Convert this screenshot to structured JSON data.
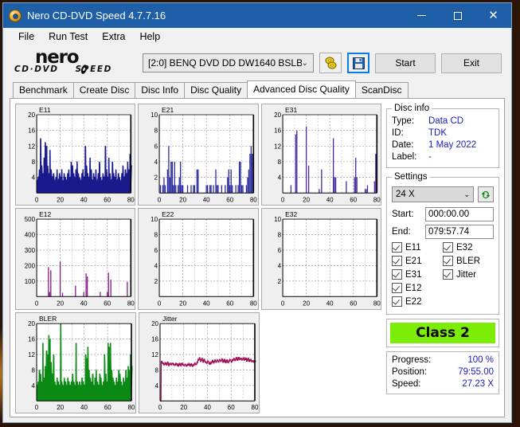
{
  "window": {
    "title": "Nero CD-DVD Speed 4.7.7.16",
    "icon": "nero-disc-icon",
    "minimize": "–",
    "maximize": "□",
    "close": "✕"
  },
  "menu": {
    "items": [
      "File",
      "Run Test",
      "Extra",
      "Help"
    ]
  },
  "toolbar": {
    "logo_primary": "nero",
    "logo_secondary": "CD·DVD",
    "logo_secondary2": "SPEED",
    "drive": "[2:0]   BENQ DVD DD DW1640 BSLB",
    "drive_chevron": "⌄",
    "eject_icon": "eject-disc-icon",
    "save_icon": "save-floppy-icon",
    "start_label": "Start",
    "exit_label": "Exit"
  },
  "tabs": [
    {
      "label": "Benchmark",
      "active": false
    },
    {
      "label": "Create Disc",
      "active": false
    },
    {
      "label": "Disc Info",
      "active": false
    },
    {
      "label": "Disc Quality",
      "active": false
    },
    {
      "label": "Advanced Disc Quality",
      "active": true
    },
    {
      "label": "ScanDisc",
      "active": false
    }
  ],
  "disc_info": {
    "legend": "Disc info",
    "rows": [
      {
        "key": "Type:",
        "value": "Data CD"
      },
      {
        "key": "ID:",
        "value": "TDK"
      },
      {
        "key": "Date:",
        "value": "1 May 2022"
      },
      {
        "key": "Label:",
        "value": "-"
      }
    ]
  },
  "settings": {
    "legend": "Settings",
    "speed": "24 X",
    "speed_chevron": "⌄",
    "refresh_icon": "refresh-speed-icon",
    "start_label": "Start:",
    "start_value": "000:00.00",
    "end_label": "End:",
    "end_value": "079:57.74",
    "checkboxes": [
      {
        "label": "E11",
        "checked": true
      },
      {
        "label": "E32",
        "checked": true
      },
      {
        "label": "E21",
        "checked": true
      },
      {
        "label": "BLER",
        "checked": true
      },
      {
        "label": "E31",
        "checked": true
      },
      {
        "label": "Jitter",
        "checked": true
      },
      {
        "label": "E12",
        "checked": true
      },
      {
        "label": "",
        "checked": false
      },
      {
        "label": "E22",
        "checked": true
      },
      {
        "label": "",
        "checked": false
      }
    ]
  },
  "quality_class": {
    "label": "Class 2",
    "color": "#7bed07"
  },
  "status": {
    "rows": [
      {
        "key": "Progress:",
        "value": "100 %"
      },
      {
        "key": "Position:",
        "value": "79:55.00"
      },
      {
        "key": "Speed:",
        "value": "27.23 X"
      }
    ]
  },
  "chart_data": [
    {
      "type": "area",
      "name": "E11",
      "title": "E11",
      "color": "#1a1a8c",
      "xlabel": "",
      "ylabel": "",
      "xlim": [
        0,
        80
      ],
      "ylim": [
        0,
        20
      ],
      "xticks": [
        0,
        20,
        40,
        60,
        80
      ],
      "yticks": [
        4,
        8,
        12,
        16,
        20
      ],
      "grid": true,
      "x": [
        0,
        1,
        2,
        3,
        4,
        5,
        6,
        7,
        8,
        9,
        10,
        11,
        12,
        13,
        14,
        15,
        16,
        17,
        18,
        19,
        20,
        21,
        22,
        23,
        24,
        25,
        26,
        27,
        28,
        29,
        30,
        31,
        32,
        33,
        34,
        35,
        36,
        37,
        38,
        39,
        40,
        41,
        42,
        43,
        44,
        45,
        46,
        47,
        48,
        49,
        50,
        51,
        52,
        53,
        54,
        55,
        56,
        57,
        58,
        59,
        60,
        61,
        62,
        63,
        64,
        65,
        66,
        67,
        68,
        69,
        70,
        71,
        72,
        73,
        74,
        75,
        76,
        77,
        78,
        79,
        80
      ],
      "values": [
        3,
        4,
        6,
        14,
        7,
        5,
        9,
        13,
        12,
        7,
        5,
        11,
        6,
        4,
        5,
        3,
        4,
        6,
        3,
        5,
        4,
        6,
        3,
        5,
        4,
        3,
        5,
        6,
        4,
        8,
        7,
        5,
        4,
        6,
        8,
        5,
        4,
        3,
        5,
        6,
        4,
        12,
        7,
        5,
        4,
        9,
        6,
        3,
        5,
        4,
        6,
        3,
        5,
        8,
        4,
        3,
        5,
        4,
        12,
        6,
        4,
        9,
        5,
        3,
        8,
        5,
        4,
        6,
        3,
        5,
        4,
        3,
        5,
        7,
        4,
        6,
        5,
        8,
        6,
        10,
        7
      ]
    },
    {
      "type": "bar",
      "name": "E21",
      "title": "E21",
      "color": "#2a2a9e",
      "xlim": [
        0,
        80
      ],
      "ylim": [
        0,
        10
      ],
      "xticks": [
        0,
        20,
        40,
        60,
        80
      ],
      "yticks": [
        2,
        4,
        6,
        8,
        10
      ],
      "grid": true,
      "x": [
        0,
        1,
        2,
        3,
        4,
        5,
        6,
        7,
        8,
        9,
        10,
        11,
        12,
        13,
        14,
        15,
        16,
        17,
        18,
        19,
        20,
        21,
        22,
        23,
        24,
        25,
        26,
        27,
        28,
        29,
        30,
        31,
        32,
        33,
        34,
        35,
        36,
        37,
        38,
        39,
        40,
        41,
        42,
        43,
        44,
        45,
        46,
        47,
        48,
        49,
        50,
        51,
        52,
        53,
        54,
        55,
        56,
        57,
        58,
        59,
        60,
        61,
        62,
        63,
        64,
        65,
        66,
        67,
        68,
        69,
        70,
        71,
        72,
        73,
        74,
        75,
        76,
        77,
        78,
        79,
        80
      ],
      "values": [
        0,
        1,
        0,
        1,
        2,
        1,
        0,
        3,
        6,
        2,
        4,
        4,
        1,
        4,
        1,
        0,
        1,
        2,
        4,
        1,
        1,
        0,
        0,
        0,
        1,
        0,
        0,
        1,
        0,
        1,
        1,
        0,
        3,
        3,
        0,
        0,
        0,
        0,
        0,
        0,
        1,
        1,
        0,
        1,
        1,
        0,
        1,
        0,
        3,
        1,
        1,
        0,
        0,
        1,
        0,
        0,
        1,
        0,
        2,
        3,
        1,
        3,
        1,
        0,
        0,
        1,
        0,
        1,
        4,
        4,
        1,
        1,
        0,
        0,
        1,
        2,
        3,
        5,
        6,
        5,
        4
      ]
    },
    {
      "type": "bar",
      "name": "E31",
      "title": "E31",
      "color": "#4a2a9e",
      "xlim": [
        0,
        80
      ],
      "ylim": [
        0,
        20
      ],
      "xticks": [
        0,
        20,
        40,
        60,
        80
      ],
      "yticks": [
        4,
        8,
        12,
        16,
        20
      ],
      "grid": true,
      "x": [
        0,
        1,
        2,
        3,
        4,
        5,
        6,
        7,
        8,
        9,
        10,
        11,
        12,
        13,
        14,
        15,
        16,
        17,
        18,
        19,
        20,
        21,
        22,
        23,
        24,
        25,
        26,
        27,
        28,
        29,
        30,
        31,
        32,
        33,
        34,
        35,
        36,
        37,
        38,
        39,
        40,
        41,
        42,
        43,
        44,
        45,
        46,
        47,
        48,
        49,
        50,
        51,
        52,
        53,
        54,
        55,
        56,
        57,
        58,
        59,
        60,
        61,
        62,
        63,
        64,
        65,
        66,
        67,
        68,
        69,
        70,
        71,
        72,
        73,
        74,
        75,
        76,
        77,
        78,
        79,
        80
      ],
      "values": [
        0,
        0,
        0,
        0,
        0,
        0,
        0,
        2,
        0,
        0,
        0,
        15,
        16,
        0,
        0,
        0,
        0,
        0,
        0,
        0,
        17,
        0,
        7,
        0,
        0,
        0,
        0,
        0,
        0,
        0,
        0,
        1,
        0,
        6,
        0,
        0,
        0,
        0,
        0,
        0,
        0,
        0,
        0,
        14,
        4,
        4,
        0,
        0,
        0,
        0,
        0,
        0,
        0,
        0,
        3,
        0,
        0,
        0,
        0,
        0,
        0,
        4,
        9,
        4,
        0,
        0,
        0,
        0,
        0,
        0,
        1,
        1,
        2,
        0,
        0,
        0,
        0,
        0,
        3,
        10,
        3
      ]
    },
    {
      "type": "bar",
      "name": "E12",
      "title": "E12",
      "color": "#8a1a8a",
      "xlim": [
        0,
        80
      ],
      "ylim": [
        0,
        500
      ],
      "xticks": [
        0,
        20,
        40,
        60,
        80
      ],
      "yticks": [
        100,
        200,
        300,
        400,
        500
      ],
      "grid": true,
      "x": [
        0,
        1,
        2,
        3,
        4,
        5,
        6,
        7,
        8,
        9,
        10,
        11,
        12,
        13,
        14,
        15,
        16,
        17,
        18,
        19,
        20,
        21,
        22,
        23,
        24,
        25,
        26,
        27,
        28,
        29,
        30,
        31,
        32,
        33,
        34,
        35,
        36,
        37,
        38,
        39,
        40,
        41,
        42,
        43,
        44,
        45,
        46,
        47,
        48,
        49,
        50,
        51,
        52,
        53,
        54,
        55,
        56,
        57,
        58,
        59,
        60,
        61,
        62,
        63,
        64,
        65,
        66,
        67,
        68,
        69,
        70,
        71,
        72,
        73,
        74,
        75,
        76,
        77,
        78,
        79,
        80
      ],
      "values": [
        0,
        0,
        0,
        0,
        0,
        0,
        0,
        0,
        0,
        0,
        190,
        30,
        170,
        0,
        0,
        0,
        0,
        0,
        0,
        0,
        225,
        0,
        25,
        0,
        0,
        0,
        0,
        0,
        0,
        0,
        0,
        0,
        0,
        70,
        0,
        0,
        0,
        0,
        0,
        0,
        30,
        0,
        150,
        130,
        0,
        0,
        0,
        0,
        0,
        0,
        0,
        0,
        0,
        0,
        30,
        0,
        0,
        0,
        0,
        0,
        30,
        155,
        0,
        110,
        0,
        0,
        0,
        0,
        0,
        0,
        0,
        0,
        0,
        0,
        0,
        0,
        0,
        95,
        0,
        0,
        0
      ]
    },
    {
      "type": "bar",
      "name": "E22",
      "title": "E22",
      "color": "#2a2a9e",
      "xlim": [
        0,
        80
      ],
      "ylim": [
        0,
        10
      ],
      "xticks": [
        0,
        20,
        40,
        60,
        80
      ],
      "yticks": [
        2,
        4,
        6,
        8,
        10
      ],
      "grid": true,
      "x": [
        0,
        20,
        40,
        60,
        80
      ],
      "values": [
        0,
        0,
        0,
        0,
        0
      ]
    },
    {
      "type": "bar",
      "name": "E32",
      "title": "E32",
      "color": "#2a2a9e",
      "xlim": [
        0,
        80
      ],
      "ylim": [
        0,
        10
      ],
      "xticks": [
        0,
        20,
        40,
        60,
        80
      ],
      "yticks": [
        2,
        4,
        6,
        8,
        10
      ],
      "grid": true,
      "x": [
        0,
        20,
        40,
        60,
        80
      ],
      "values": [
        0,
        0,
        0,
        0,
        0
      ]
    },
    {
      "type": "area",
      "name": "BLER",
      "title": "BLER",
      "color": "#0a8a14",
      "xlim": [
        0,
        80
      ],
      "ylim": [
        0,
        20
      ],
      "xticks": [
        0,
        20,
        40,
        60,
        80
      ],
      "yticks": [
        4,
        8,
        12,
        16,
        20
      ],
      "grid": true,
      "x": [
        0,
        1,
        2,
        3,
        4,
        5,
        6,
        7,
        8,
        9,
        10,
        11,
        12,
        13,
        14,
        15,
        16,
        17,
        18,
        19,
        20,
        21,
        22,
        23,
        24,
        25,
        26,
        27,
        28,
        29,
        30,
        31,
        32,
        33,
        34,
        35,
        36,
        37,
        38,
        39,
        40,
        41,
        42,
        43,
        44,
        45,
        46,
        47,
        48,
        49,
        50,
        51,
        52,
        53,
        54,
        55,
        56,
        57,
        58,
        59,
        60,
        61,
        62,
        63,
        64,
        65,
        66,
        67,
        68,
        69,
        70,
        71,
        72,
        73,
        74,
        75,
        76,
        77,
        78,
        79,
        80
      ],
      "values": [
        4,
        5,
        8,
        7,
        5,
        15,
        6,
        9,
        13,
        12,
        17,
        16,
        10,
        7,
        12,
        5,
        4,
        6,
        5,
        4,
        20,
        5,
        4,
        6,
        5,
        4,
        6,
        5,
        4,
        5,
        7,
        5,
        4,
        15,
        5,
        4,
        5,
        4,
        6,
        5,
        4,
        12,
        11,
        14,
        8,
        6,
        5,
        7,
        4,
        6,
        8,
        5,
        4,
        7,
        6,
        4,
        5,
        12,
        7,
        5,
        15,
        14,
        15,
        8,
        6,
        5,
        4,
        6,
        5,
        8,
        7,
        5,
        4,
        6,
        5,
        8,
        6,
        9,
        8,
        12,
        9
      ]
    },
    {
      "type": "line",
      "name": "Jitter",
      "title": "Jitter",
      "color": "#9e1155",
      "xlim": [
        0,
        80
      ],
      "ylim": [
        0,
        20
      ],
      "xticks": [
        0,
        20,
        40,
        60,
        80
      ],
      "yticks": [
        4,
        8,
        12,
        16,
        20
      ],
      "grid": true,
      "x": [
        0,
        1,
        2,
        3,
        4,
        5,
        6,
        7,
        8,
        9,
        10,
        11,
        12,
        13,
        14,
        15,
        16,
        17,
        18,
        19,
        20,
        21,
        22,
        23,
        24,
        25,
        26,
        27,
        28,
        29,
        30,
        31,
        32,
        33,
        34,
        35,
        36,
        37,
        38,
        39,
        40,
        41,
        42,
        43,
        44,
        45,
        46,
        47,
        48,
        49,
        50,
        51,
        52,
        53,
        54,
        55,
        56,
        57,
        58,
        59,
        60,
        61,
        62,
        63,
        64,
        65,
        66,
        67,
        68,
        69,
        70,
        71,
        72,
        73,
        74,
        75,
        76,
        77,
        78,
        79,
        80
      ],
      "values": [
        0,
        10.2,
        9.8,
        9.4,
        9.7,
        9.5,
        9.8,
        9.3,
        9.6,
        9.4,
        9.7,
        9.5,
        9.3,
        9.6,
        9.4,
        9.2,
        9.5,
        9.3,
        9.6,
        9.4,
        9.2,
        9.4,
        9.1,
        9.3,
        9.5,
        9.2,
        9.4,
        9.1,
        9.3,
        9.6,
        9.4,
        10.0,
        10.6,
        11.0,
        10.4,
        10.8,
        10.2,
        10.6,
        10.0,
        9.8,
        10.2,
        9.8,
        9.6,
        9.9,
        10.3,
        10.0,
        10.4,
        10.1,
        10.5,
        10.2,
        10.6,
        10.3,
        10.7,
        10.2,
        10.5,
        10.1,
        10.4,
        10.0,
        10.3,
        10.6,
        10.2,
        10.5,
        10.8,
        10.6,
        11.0,
        10.7,
        11.1,
        10.8,
        11.0,
        10.6,
        11.0,
        10.7,
        10.9,
        10.5,
        10.8,
        10.4,
        10.6,
        10.2,
        10.4,
        10.0,
        10.2
      ]
    }
  ]
}
